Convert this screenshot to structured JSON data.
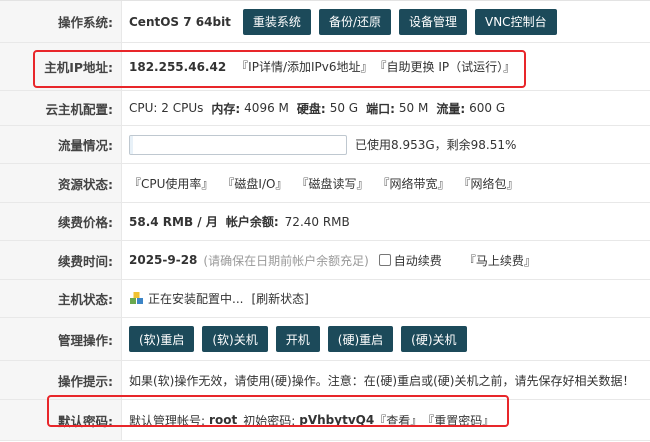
{
  "rows": {
    "os": {
      "label": "操作系统:",
      "value": "CentOS 7 64bit",
      "buttons": [
        "重装系统",
        "备份/还原",
        "设备管理",
        "VNC控制台"
      ]
    },
    "ip": {
      "label": "主机IP地址:",
      "value": "182.255.46.42",
      "links": [
        "『IP详情/添加IPv6地址』",
        "『自助更换 IP（试运行）』"
      ]
    },
    "config": {
      "label": "云主机配置:",
      "cpu": "CPU: 2 CPUs",
      "mem_label": "内存:",
      "mem": "4096 M",
      "disk_label": "硬盘:",
      "disk": "50 G",
      "port_label": "端口:",
      "port": "50 M",
      "traffic_label": "流量:",
      "traffic": "600 G"
    },
    "traffic": {
      "label": "流量情况:",
      "used_fraction": 0.0149,
      "text": "已使用8.953G，剩余98.51%"
    },
    "resources": {
      "label": "资源状态:",
      "links": [
        "『CPU使用率』",
        "『磁盘I/O』",
        "『磁盘读写』",
        "『网络带宽』",
        "『网络包』"
      ]
    },
    "price": {
      "label": "续费价格:",
      "value": "58.4 RMB / 月",
      "balance_label": "帐户余额:",
      "balance": "72.40 RMB"
    },
    "renew": {
      "label": "续费时间:",
      "date": "2025-9-28",
      "note": "(请确保在日期前帐户余额充足)",
      "auto_label": "自动续费",
      "now_link": "『马上续费』"
    },
    "status": {
      "label": "主机状态:",
      "text": "正在安装配置中...",
      "refresh": "[刷新状态]"
    },
    "manage": {
      "label": "管理操作:",
      "buttons": [
        "(软)重启",
        "(软)关机",
        "开机",
        "(硬)重启",
        "(硬)关机"
      ]
    },
    "tip": {
      "label": "操作提示:",
      "text": "如果(软)操作无效，请使用(硬)操作。注意：在(硬)重启或(硬)关机之前，请先保存好相关数据！"
    },
    "password": {
      "label": "默认密码:",
      "account_label": "默认管理帐号:",
      "account": "root",
      "pwd_label": "初始密码:",
      "pwd": "pVhbytvQ4",
      "view_link": "『查看』",
      "reset_link": "『重置密码』"
    }
  },
  "colors": {
    "button_bg": "#1c4a5a",
    "highlight": "#e8262a"
  },
  "icons": {
    "status": "install-status-icon"
  }
}
